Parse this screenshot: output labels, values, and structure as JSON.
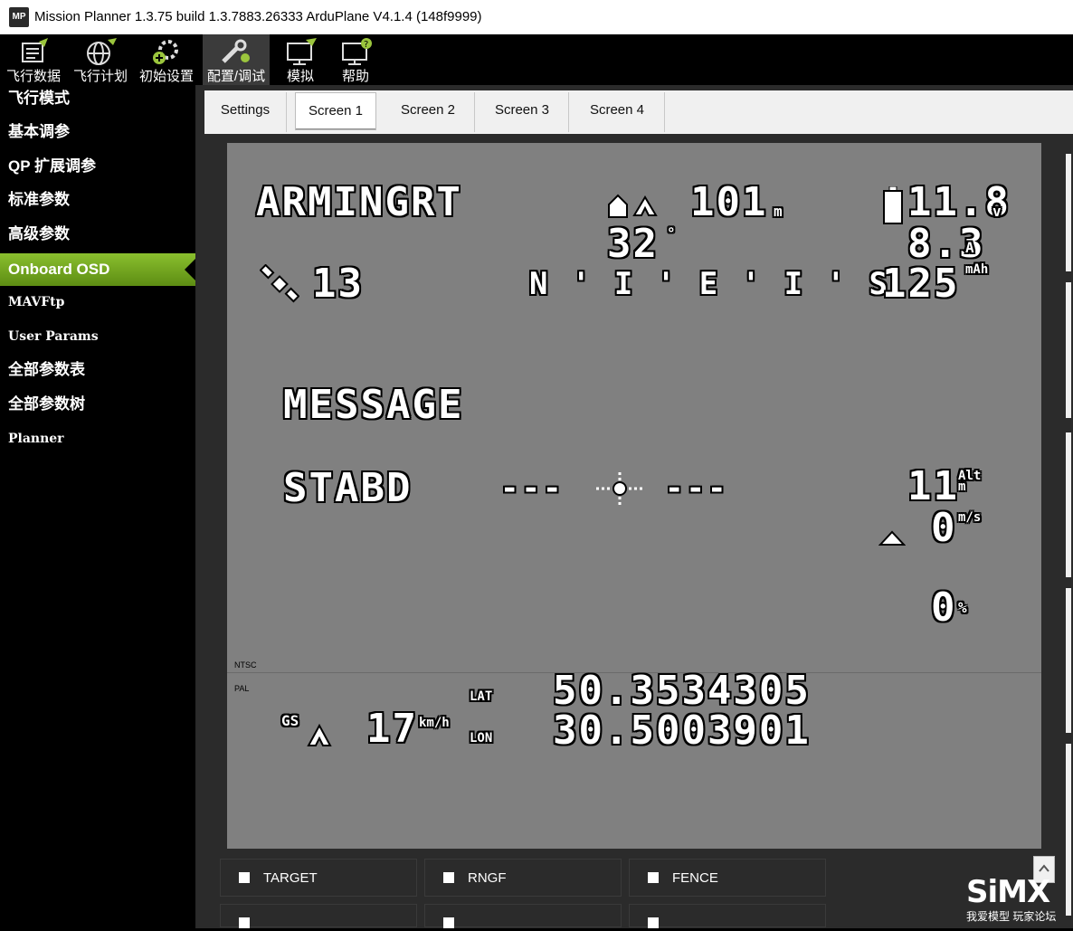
{
  "window": {
    "logo_text": "MP",
    "title": "Mission Planner 1.3.75 build 1.3.7883.26333 ArduPlane V4.1.4 (148f9999)"
  },
  "toolbar": [
    {
      "label": "飞行数据",
      "icon": "flight-data-icon"
    },
    {
      "label": "飞行计划",
      "icon": "flight-plan-icon"
    },
    {
      "label": "初始设置",
      "icon": "initial-setup-icon"
    },
    {
      "label": "配置/调试",
      "icon": "config-tuning-icon"
    },
    {
      "label": "模拟",
      "icon": "simulation-icon"
    },
    {
      "label": "帮助",
      "icon": "help-icon"
    }
  ],
  "sidebar": [
    {
      "label": "飞行模式"
    },
    {
      "label": "基本调参"
    },
    {
      "label": "QP 扩展调参"
    },
    {
      "label": "标准参数"
    },
    {
      "label": "高级参数"
    },
    {
      "label": "Onboard OSD"
    },
    {
      "label": "MAVFtp"
    },
    {
      "label": "User Params"
    },
    {
      "label": "全部参数表"
    },
    {
      "label": "全部参数树"
    },
    {
      "label": "Planner"
    }
  ],
  "tabs": [
    "Settings",
    "Screen 1",
    "Screen 2",
    "Screen 3",
    "Screen 4"
  ],
  "active_tab": "Screen 1",
  "osd": {
    "arming": "ARMINGRT",
    "home_dist_value": "101",
    "home_dist_unit": "m",
    "home_dir": "32",
    "home_dir_unit": "°",
    "battery_voltage": "11.8",
    "battery_voltage_unit": "v",
    "current": "8.3",
    "current_unit": "A",
    "mah": "125",
    "mah_unit": "mAh",
    "sats": "13",
    "compass": "N ' I ' E ' I ' S",
    "message": "MESSAGE",
    "mode": "STABD",
    "horizon_left": "---",
    "horizon_right": "---",
    "alt_value": "11",
    "alt_unit": "Alt m",
    "vspeed_value": "0",
    "vspeed_unit": "m/s",
    "throttle_value": "0",
    "throttle_unit": "%",
    "ntsc_label": "NTSC",
    "pal_label": "PAL",
    "gs_label": "GS",
    "gs_value": "17",
    "gs_unit": "km/h",
    "lat_label": "LAT",
    "lat_value": "50.3534305",
    "lon_label": "LON",
    "lon_value": "30.5003901"
  },
  "checkboxes": [
    {
      "label": "TARGET",
      "checked": false
    },
    {
      "label": "RNGF",
      "checked": false
    },
    {
      "label": "FENCE",
      "checked": false
    }
  ],
  "watermark": {
    "brand": "SiMX",
    "subtitle": "我爱模型 玩家论坛"
  }
}
